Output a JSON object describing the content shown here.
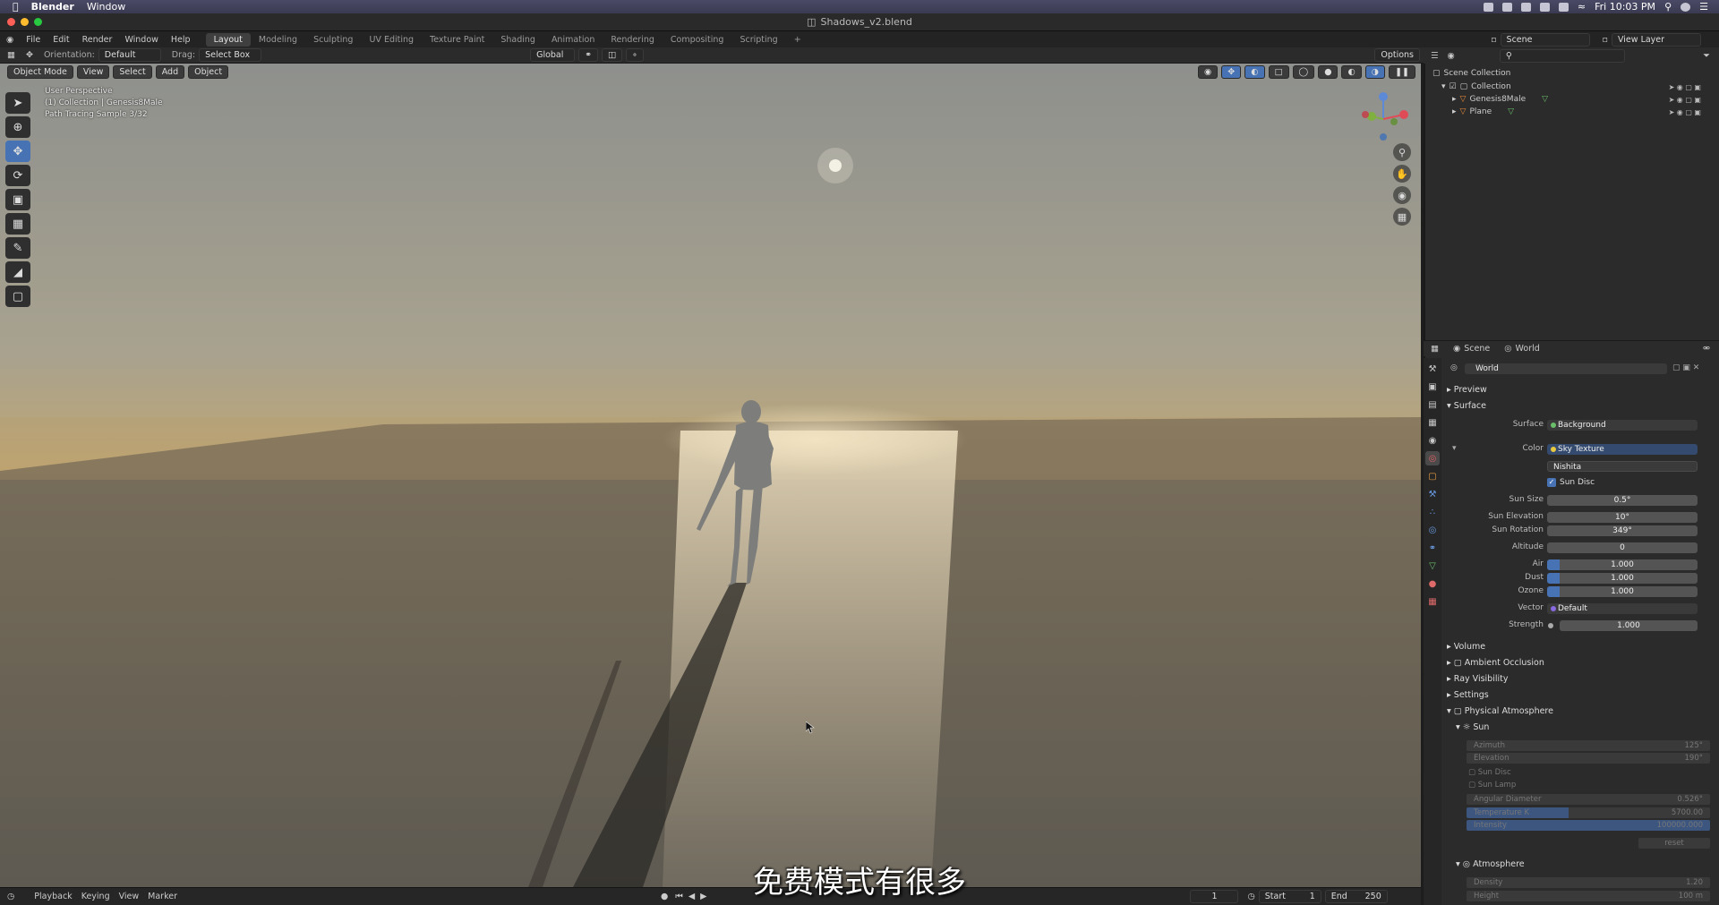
{
  "mac_menubar": {
    "app": "Blender",
    "menu": "Window",
    "clock": "Fri 10:03 PM"
  },
  "window": {
    "title": "Shadows_v2.blend"
  },
  "topbar": {
    "menus": [
      "File",
      "Edit",
      "Render",
      "Window",
      "Help"
    ],
    "workspaces": [
      "Layout",
      "Modeling",
      "Sculpting",
      "UV Editing",
      "Texture Paint",
      "Shading",
      "Animation",
      "Rendering",
      "Compositing",
      "Scripting"
    ],
    "active_workspace": "Layout",
    "scene": "Scene",
    "view_layer": "View Layer"
  },
  "tool_header": {
    "orientation_label": "Orientation:",
    "orientation_value": "Default",
    "drag_label": "Drag:",
    "drag_value": "Select Box",
    "transform": "Global",
    "options": "Options"
  },
  "viewport_header": {
    "mode": "Object Mode",
    "menus": [
      "View",
      "Select",
      "Add",
      "Object"
    ]
  },
  "viewport_info": {
    "line1": "User Perspective",
    "line2": "(1) Collection | Genesis8Male",
    "line3": "Path Tracing Sample 3/32"
  },
  "outliner": {
    "root": "Scene Collection",
    "collection": "Collection",
    "items": [
      "Genesis8Male",
      "Plane"
    ]
  },
  "properties": {
    "context_scene": "Scene",
    "context_world": "World",
    "world_name": "World",
    "sections": {
      "preview": "Preview",
      "surface": "Surface"
    },
    "surface_label": "Surface",
    "surface_value": "Background",
    "color_label": "Color",
    "color_value": "Sky Texture",
    "sky_type": "Nishita",
    "sun_disc": "Sun Disc",
    "sun_size_label": "Sun Size",
    "sun_size": "0.5°",
    "sun_elev_label": "Sun Elevation",
    "sun_elev": "10°",
    "sun_rot_label": "Sun Rotation",
    "sun_rot": "349°",
    "altitude_label": "Altitude",
    "altitude": "0",
    "air_label": "Air",
    "air": "1.000",
    "dust_label": "Dust",
    "dust": "1.000",
    "ozone_label": "Ozone",
    "ozone": "1.000",
    "vector_label": "Vector",
    "vector": "Default",
    "strength_label": "Strength",
    "strength": "1.000",
    "collapsed": [
      "Volume",
      "Ambient Occlusion",
      "Ray Visibility",
      "Settings"
    ],
    "physical_atmosphere": "Physical Atmosphere",
    "sun_panel": "Sun",
    "sun_fields": [
      {
        "label": "Azimuth",
        "value": "125°"
      },
      {
        "label": "Elevation",
        "value": "190°"
      },
      {
        "label": "Sun Disc",
        "value": ""
      },
      {
        "label": "Sun Lamp",
        "value": ""
      },
      {
        "label": "Angular Diameter",
        "value": "0.526°"
      },
      {
        "label": "Temperature K",
        "value": "5700.00"
      },
      {
        "label": "Intensity",
        "value": "100000.000"
      }
    ],
    "reset": "reset",
    "atmosphere_panel": "Atmosphere",
    "atmo_fields": [
      {
        "label": "Density",
        "value": "1.20"
      },
      {
        "label": "Height",
        "value": "100 m"
      }
    ]
  },
  "timeline": {
    "menus": [
      "Playback",
      "Keying",
      "View",
      "Marker"
    ],
    "current_frame": "1",
    "start_label": "Start",
    "start": "1",
    "end_label": "End",
    "end": "250"
  },
  "subtitle": "免费模式有很多",
  "colors": {
    "accent": "#4772b3",
    "panel": "#2b2b2b",
    "sky_top": "#8c8d8a",
    "sky_horizon": "#c29a5c",
    "ground": "#6e6455"
  }
}
